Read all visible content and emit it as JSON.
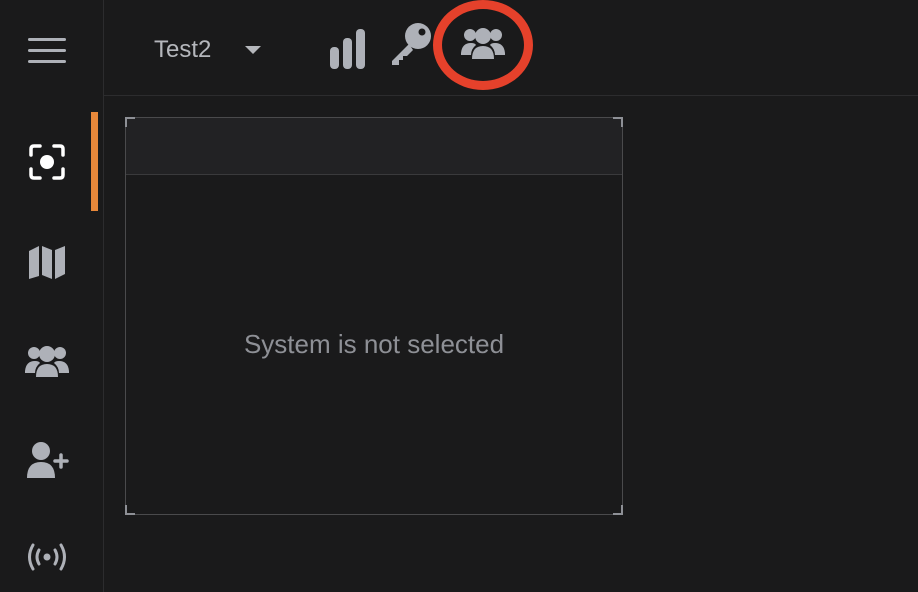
{
  "topbar": {
    "system_name": "Test2"
  },
  "icons": {
    "menu": "hamburger-icon",
    "stats": "bar-chart-icon",
    "key": "key-icon",
    "users": "users-icon",
    "camera": "camera-focus-icon",
    "map": "map-icon",
    "group": "users-icon",
    "add_user": "user-plus-icon",
    "broadcast": "broadcast-icon"
  },
  "panel": {
    "empty_message": "System is not selected"
  },
  "colors": {
    "background": "#1a1a1b",
    "icon": "#aeb1b8",
    "accent": "#e8883a",
    "highlight": "#e5412b"
  }
}
